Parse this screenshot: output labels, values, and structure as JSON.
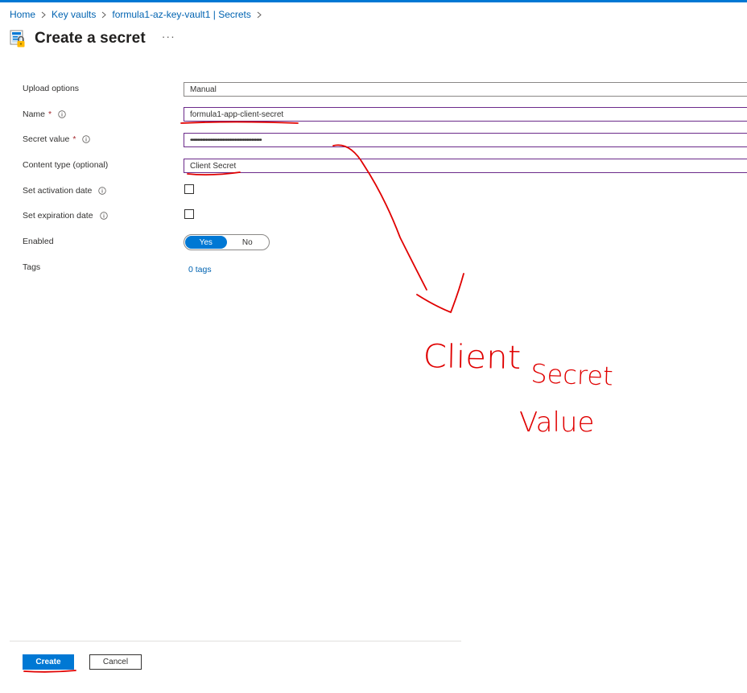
{
  "breadcrumb": {
    "items": [
      "Home",
      "Key vaults",
      "formula1-az-key-vault1 | Secrets"
    ]
  },
  "header": {
    "title": "Create a secret",
    "more_label": "···"
  },
  "form": {
    "upload_options": {
      "label": "Upload options",
      "value": "Manual"
    },
    "name": {
      "label": "Name",
      "required_marker": "*",
      "value": "formula1-app-client-secret"
    },
    "secret_value": {
      "label": "Secret value",
      "required_marker": "*",
      "value": "••••••••••••••••••••••••••••••••••••••••••"
    },
    "content_type": {
      "label": "Content type (optional)",
      "value": "Client Secret"
    },
    "activation_date": {
      "label": "Set activation date",
      "checked": false
    },
    "expiration_date": {
      "label": "Set expiration date",
      "checked": false
    },
    "enabled": {
      "label": "Enabled",
      "options": [
        "Yes",
        "No"
      ],
      "selected": "Yes"
    },
    "tags": {
      "label": "Tags",
      "link": "0 tags"
    }
  },
  "footer": {
    "create_label": "Create",
    "cancel_label": "Cancel"
  },
  "annotations": {
    "line1": "Client",
    "line2": "Secret",
    "line3": "Value",
    "color": "#e00000"
  },
  "colors": {
    "accent": "#0078d4",
    "link": "#0063b1",
    "focus_border": "#6b2a8a",
    "required": "#a4262c"
  }
}
